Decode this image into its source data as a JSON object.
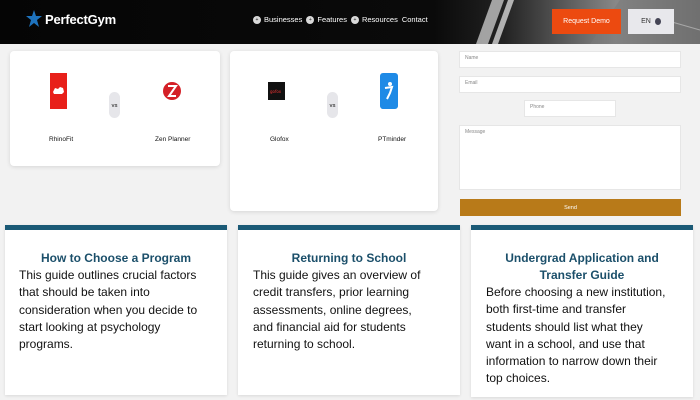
{
  "header": {
    "logo_text": "PerfectGym",
    "logo_icon": "star-figure-icon",
    "nav": [
      {
        "label": "Businesses",
        "icon": "plus-circle-icon"
      },
      {
        "label": "Features",
        "icon": "plus-circle-icon"
      },
      {
        "label": "Resources",
        "icon": "plus-circle-icon"
      },
      {
        "label": "Contact"
      }
    ],
    "request_demo_label": "Request Demo",
    "language_label": "EN",
    "accent_color": "#ec4a10"
  },
  "comparisons": [
    {
      "left": {
        "name": "RhinoFit",
        "color": "#e8201a",
        "icon": "rhino-logo-icon"
      },
      "vs_label": "VS",
      "right": {
        "name": "Zen Planner",
        "color": "#d42027",
        "icon": "zen-planner-logo-icon"
      }
    },
    {
      "left": {
        "name": "Glofox",
        "color": "#111111",
        "icon": "glofox-logo-icon"
      },
      "vs_label": "VS",
      "right": {
        "name": "PTminder",
        "color": "#1e8ae6",
        "icon": "ptminder-logo-icon"
      }
    }
  ],
  "form": {
    "name_placeholder": "Name",
    "email_placeholder": "Email",
    "phone_placeholder": "Phone",
    "message_placeholder": "Message",
    "send_label": "Send",
    "send_color": "#b87a19"
  },
  "guides": [
    {
      "title": "How to Choose a Program",
      "body": [
        "This guide outlines crucial factors",
        "that should be taken into",
        "consideration when you decide to",
        "start looking at psychology",
        "programs."
      ]
    },
    {
      "title": "Returning to School",
      "body": [
        "This guide gives an overview of",
        "credit transfers, prior learning",
        "assessments, online degrees,",
        "and financial aid for students",
        "returning to school."
      ]
    },
    {
      "title_lines": [
        "Undergrad Application and",
        "Transfer Guide"
      ],
      "body": [
        "Before choosing a new institution,",
        "both first-time and transfer",
        "students should list what they",
        "want in a school, and use that",
        "information to narrow down their",
        "top choices."
      ]
    }
  ],
  "theme": {
    "guide_accent": "#1b5a76"
  }
}
